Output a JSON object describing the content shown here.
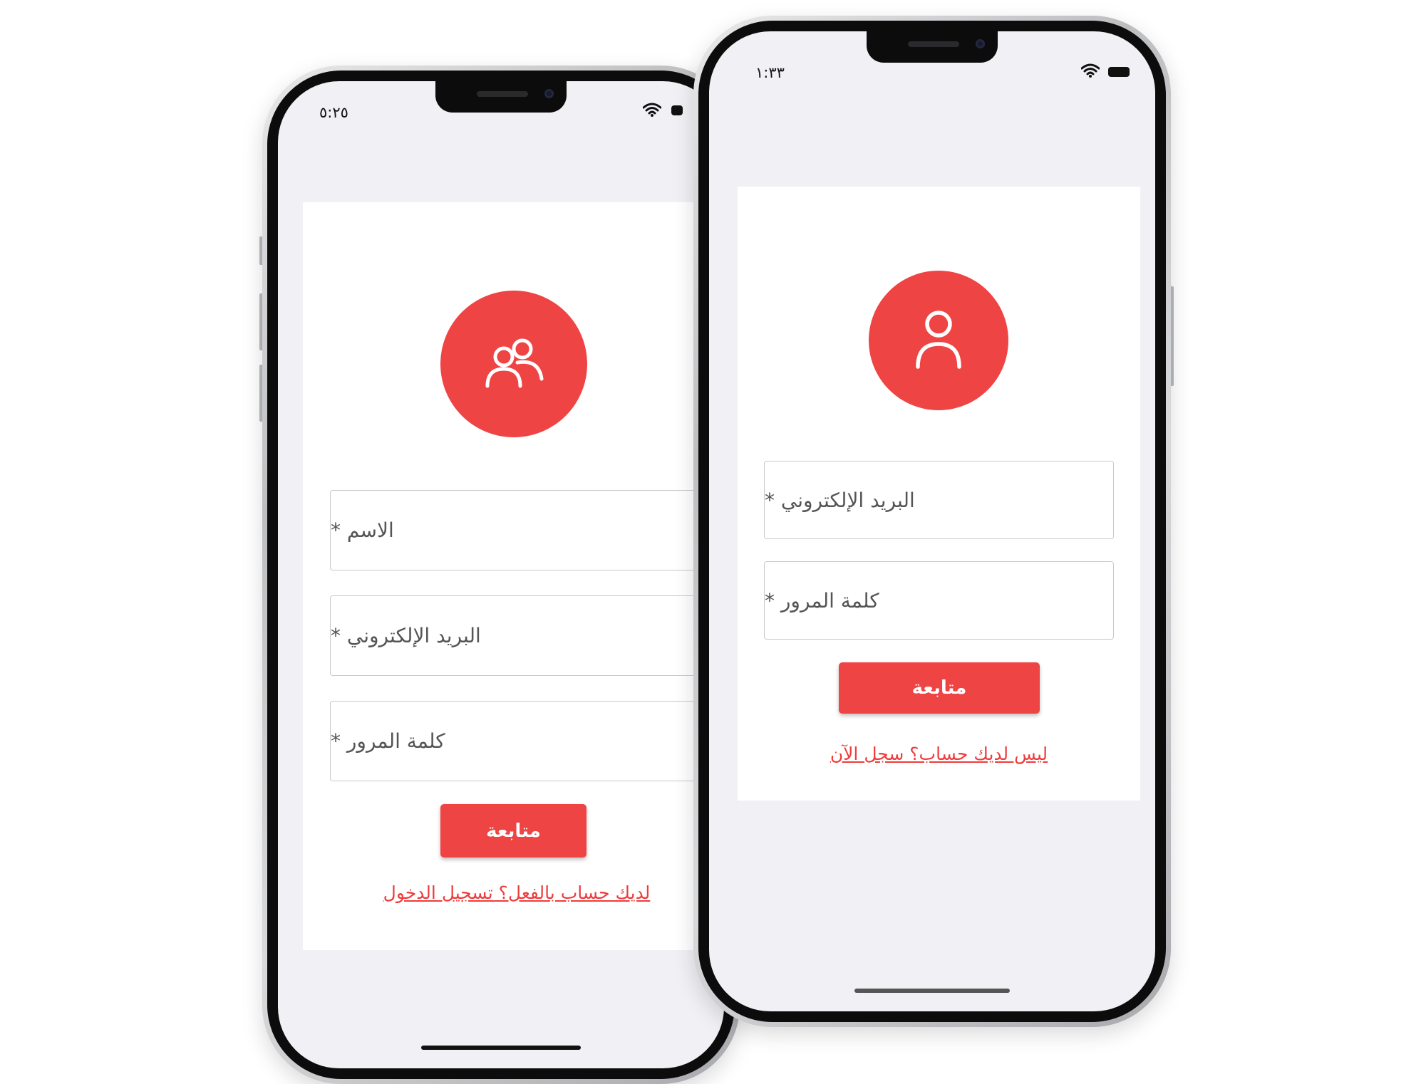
{
  "register_screen": {
    "status_time": "٥:٢٥",
    "avatar_icon": "users-group-icon",
    "fields": [
      {
        "label": "الاسم *"
      },
      {
        "label": "البريد الإلكتروني *"
      },
      {
        "label": "كلمة المرور *"
      }
    ],
    "submit_label": "متابعة",
    "link_text": "لديك حساب بالفعل؟ تسجيل الدخول"
  },
  "login_screen": {
    "status_time": "١:٣٣",
    "avatar_icon": "user-icon",
    "fields": [
      {
        "label": "البريد الإلكتروني *"
      },
      {
        "label": "كلمة المرور *"
      }
    ],
    "submit_label": "متابعة",
    "link_text": "ليس لديك حساب؟ سجل الآن"
  },
  "colors": {
    "accent": "#ef4444",
    "screen_background": "#f1f1f5",
    "card_background": "#ffffff"
  }
}
